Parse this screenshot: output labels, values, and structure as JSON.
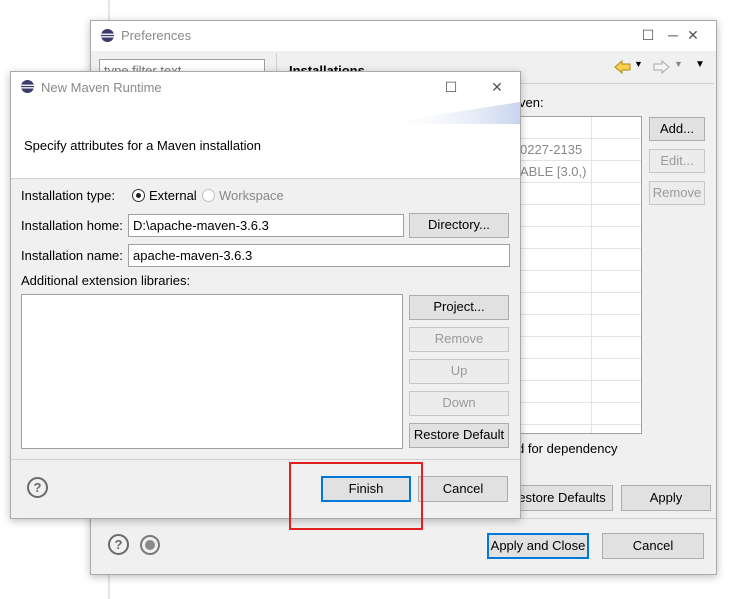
{
  "preferences": {
    "title": "Preferences",
    "filter_placeholder": "type filter text",
    "section_title": "Installations",
    "maven_label_fragment": "ven:",
    "table_rows": [
      "0227-2135",
      "ABLE [3.0,)"
    ],
    "buttons": {
      "add": "Add...",
      "edit": "Edit...",
      "remove": "Remove",
      "restore_defaults": "estore Defaults",
      "apply": "Apply",
      "apply_and_close": "Apply and Close",
      "cancel": "Cancel"
    },
    "dependency_text": "d for dependency"
  },
  "dialog": {
    "title": "New Maven Runtime",
    "description": "Specify attributes for a Maven installation",
    "installation_type_label": "Installation type:",
    "type_external": "External",
    "type_workspace": "Workspace",
    "selected_type": "External",
    "home_label": "Installation home:",
    "home_value": "D:\\apache-maven-3.6.3",
    "name_label": "Installation name:",
    "name_value": "apache-maven-3.6.3",
    "ext_libraries_label": "Additional extension libraries:",
    "buttons": {
      "directory": "Directory...",
      "project": "Project...",
      "remove": "Remove",
      "up": "Up",
      "down": "Down",
      "restore_default": "Restore Default",
      "finish": "Finish",
      "cancel": "Cancel"
    }
  },
  "annotation": {
    "highlight_color": "#e02020",
    "target": "Finish"
  }
}
